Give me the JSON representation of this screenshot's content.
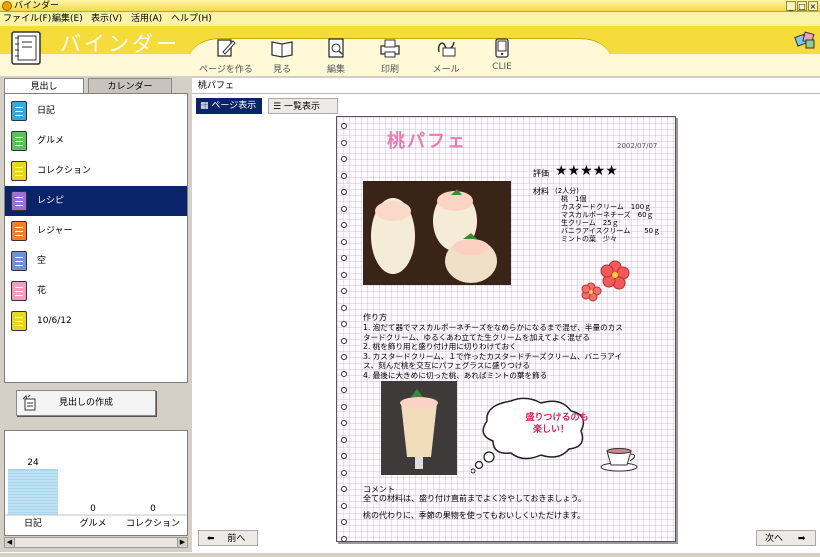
{
  "window": {
    "title": "バインダー",
    "controls": [
      "_",
      "□",
      "×"
    ]
  },
  "menu": [
    "ファイル(F)",
    "編集(E)",
    "表示(V)",
    "活用(A)",
    "ヘルプ(H)"
  ],
  "toolbar": {
    "app_label": "バインダー",
    "buttons": [
      {
        "label": "ページを作る",
        "icon": "edit-page-icon"
      },
      {
        "label": "見る",
        "icon": "open-book-icon"
      },
      {
        "label": "編集",
        "icon": "search-page-icon"
      },
      {
        "label": "印刷",
        "icon": "printer-icon"
      },
      {
        "label": "メール",
        "icon": "mail-icon"
      },
      {
        "label": "CLIE",
        "icon": "clie-device-icon"
      }
    ]
  },
  "tabs": {
    "index": "見出し",
    "calendar": "カレンダー"
  },
  "notebooks": [
    {
      "label": "日記",
      "color": "#3aa8d8"
    },
    {
      "label": "グルメ",
      "color": "#5cc05c"
    },
    {
      "label": "コレクション",
      "color": "#e8d820"
    },
    {
      "label": "レシピ",
      "color": "#a070d0"
    },
    {
      "label": "レジャー",
      "color": "#f08030"
    },
    {
      "label": "空",
      "color": "#7090d8"
    },
    {
      "label": "花",
      "color": "#f0a0c0"
    },
    {
      "label": "10/6/12",
      "color": "#e8d820"
    }
  ],
  "selected_notebook": "レシピ",
  "create_button": "見出しの作成",
  "chart_data": {
    "type": "bar",
    "categories": [
      "日記",
      "グルメ",
      "コレクション"
    ],
    "values": [
      24,
      0,
      0
    ],
    "bar_color": "#a8d8f0"
  },
  "breadcrumb": "桃パフェ",
  "view_buttons": {
    "page": "ページ表示",
    "list": "一覧表示"
  },
  "recipe": {
    "title": "桃パフェ",
    "date": "2002/07/07",
    "rating_label": "評価",
    "stars": "★★★★★",
    "ingredients_label": "材料",
    "ingredients": [
      "(2人分)",
      "桃　1個",
      "カスタードクリーム　100ｇ",
      "マスカルポーネチーズ　60ｇ",
      "生クリーム　25ｇ",
      "バニラアイスクリーム　　50ｇ",
      "ミントの葉　少々"
    ],
    "method_label": "作り方",
    "method": [
      "1.  泡だて器でマスカルポーネチーズをなめらかになるまで混ぜ、半量のカス",
      "タードクリーム、ゆるくあわ立てた生クリームを加えてよく混ぜる",
      "2.  桃を飾り用と盛り付け用に切りわけておく",
      "3.  カスタードクリーム、１で作ったカスタードチーズクリーム、バニラアイ",
      "ス、刻んだ桃を交互にパフェグラスに盛りつける",
      "4.  最後に大きめに切った桃、あればミントの葉を飾る"
    ],
    "bubble_line1": "盛りつけるのも",
    "bubble_line2": "楽しい！",
    "comment_label": "コメント",
    "comment1": "全ての材料は、盛り付け直前までよく冷やしておきましょう。",
    "comment2": "桃の代わりに、季節の果物を使ってもおいしくいただけます。"
  },
  "nav": {
    "prev": "前へ",
    "next": "次へ"
  }
}
